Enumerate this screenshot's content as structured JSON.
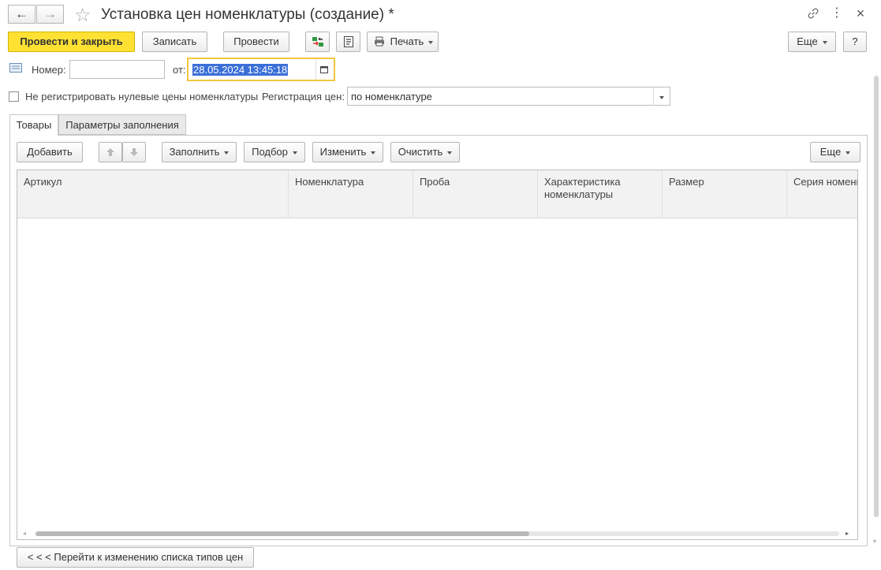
{
  "window": {
    "title": "Установка цен номенклатуры (создание) *"
  },
  "nav": {
    "back_icon": "←",
    "forward_icon": "→",
    "favorite_icon": "☆"
  },
  "window_controls": {
    "link_icon": "🔗",
    "menu_icon": "⋮",
    "close_icon": "×"
  },
  "toolbar": {
    "post_close_label": "Провести и закрыть",
    "save_label": "Записать",
    "post_label": "Провести",
    "print_label": "Печать",
    "more_label": "Еще",
    "help_label": "?"
  },
  "header_fields": {
    "number_label": "Номер:",
    "number_value": "",
    "date_label": "от:",
    "date_value": "28.05.2024 13:45:18"
  },
  "options": {
    "zero_prices_checkbox_label": "Не регистрировать нулевые цены номенклатуры",
    "zero_prices_checked": false,
    "price_registration_label": "Регистрация цен:",
    "price_registration_value": "по номенклатуре"
  },
  "tabs": [
    {
      "label": "Товары",
      "active": true
    },
    {
      "label": "Параметры заполнения",
      "active": false
    }
  ],
  "table_toolbar": {
    "add_label": "Добавить",
    "fill_label": "Заполнить",
    "select_label": "Подбор",
    "change_label": "Изменить",
    "clear_label": "Очистить",
    "more_label": "Еще"
  },
  "table": {
    "columns": [
      "Артикул",
      "Номенклатура",
      "Проба",
      "Характеристика номенклатуры",
      "Размер",
      "Серия номенклатуры"
    ],
    "rows": []
  },
  "footer": {
    "price_types_link_label": "< < < Перейти к изменению списка типов цен"
  },
  "colors": {
    "accent_yellow": "#ffe134",
    "focus_border": "#f3c73f",
    "selection": "#3a6fd8"
  }
}
